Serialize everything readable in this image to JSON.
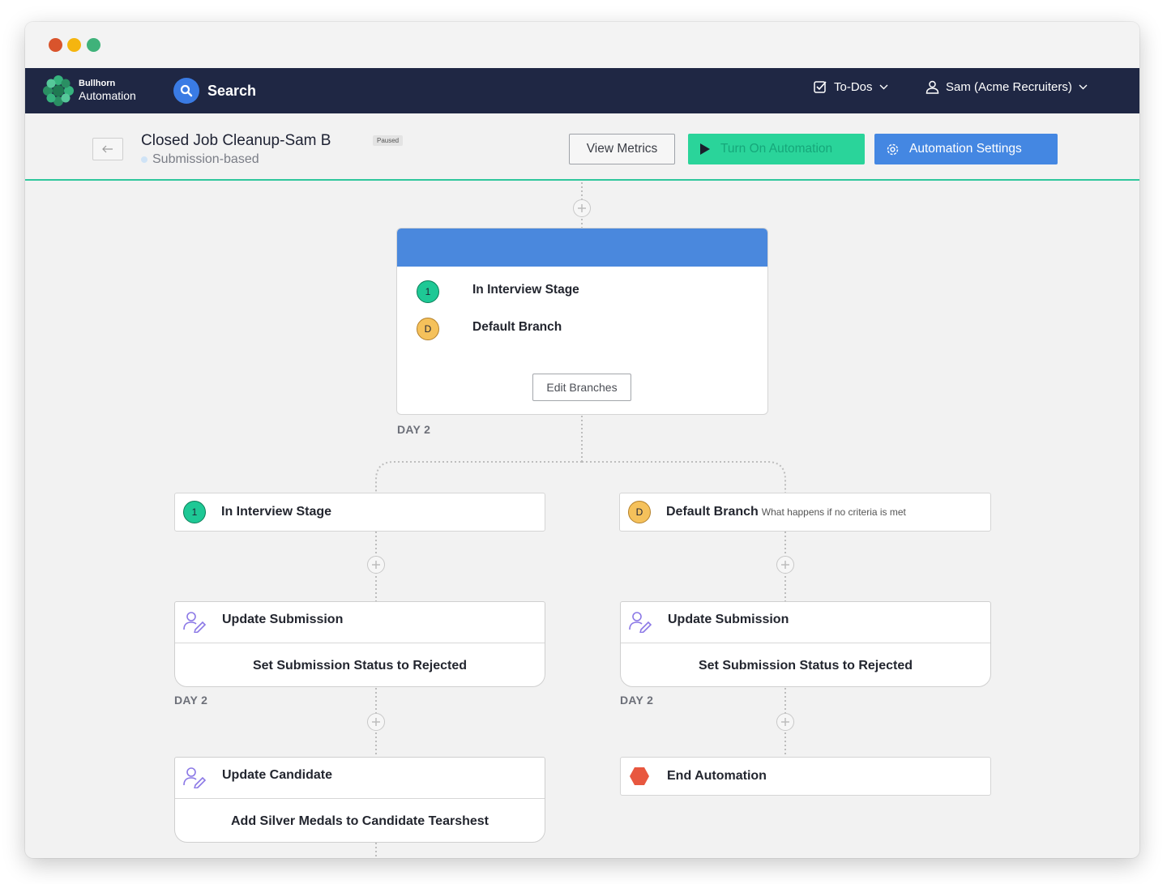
{
  "window": {
    "controls": [
      "close",
      "minimize",
      "maximize"
    ]
  },
  "navbar": {
    "brand_top": "Bullhorn",
    "brand_bottom": "Automation",
    "search_label": "Search",
    "todos_label": "To-Dos",
    "user_label": "Sam (Acme Recruiters)"
  },
  "header": {
    "title": "Closed Job Cleanup-Sam B",
    "status_badge": "Paused",
    "subtitle": "Submission-based",
    "view_metrics": "View Metrics",
    "turn_on": "Turn On Automation",
    "settings": "Automation Settings"
  },
  "branch_card": {
    "branches": [
      {
        "badge": "1",
        "label": "In Interview Stage"
      },
      {
        "badge": "D",
        "label": "Default Branch"
      }
    ],
    "edit_label": "Edit Branches",
    "day": "DAY 2"
  },
  "left_branch": {
    "badge": "1",
    "title": "In Interview Stage",
    "step1": {
      "title": "Update Submission",
      "body": "Set Submission Status to Rejected",
      "day": "DAY 2"
    },
    "step2": {
      "title": "Update Candidate",
      "body": "Add Silver Medals to Candidate Tearshest"
    }
  },
  "right_branch": {
    "badge": "D",
    "title": "Default Branch",
    "subtitle": "What happens if no criteria is met",
    "step1": {
      "title": "Update Submission",
      "body": "Set Submission Status to Rejected",
      "day": "DAY 2"
    },
    "end": {
      "title": "End Automation"
    }
  },
  "colors": {
    "navbar": "#1f2744",
    "accent_green": "#2ad49a",
    "accent_blue": "#4487e2",
    "branch_header": "#4a88dd",
    "end_red": "#e8573f"
  }
}
